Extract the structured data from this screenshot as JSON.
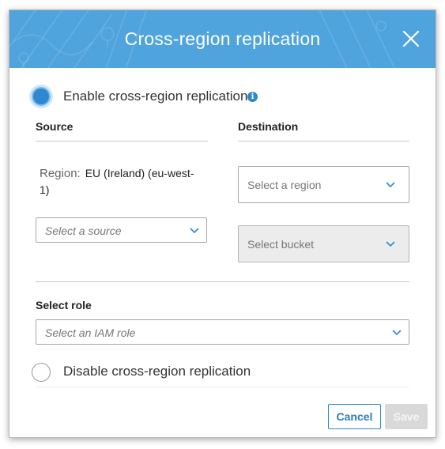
{
  "dialog": {
    "title": "Cross-region replication"
  },
  "options": {
    "enable_label": "Enable cross-region replication",
    "disable_label": "Disable cross-region replication"
  },
  "source": {
    "heading": "Source",
    "region_label": "Region:",
    "region_line1": "EU (Ireland) (eu-west-",
    "region_line2": "1)",
    "select_placeholder": "Select a source"
  },
  "destination": {
    "heading": "Destination",
    "region_placeholder": "Select a region",
    "bucket_placeholder": "Select bucket"
  },
  "role": {
    "heading": "Select role",
    "placeholder": "Select an IAM role"
  },
  "footer": {
    "cancel_label": "Cancel",
    "save_label": "Save"
  },
  "colors": {
    "header_bg": "#4fa4dd",
    "accent": "#2d88cf",
    "disabled_bg": "#ececec"
  },
  "icons": {
    "close": "close-icon",
    "info": "info-icon",
    "chevron": "chevron-down-icon"
  }
}
